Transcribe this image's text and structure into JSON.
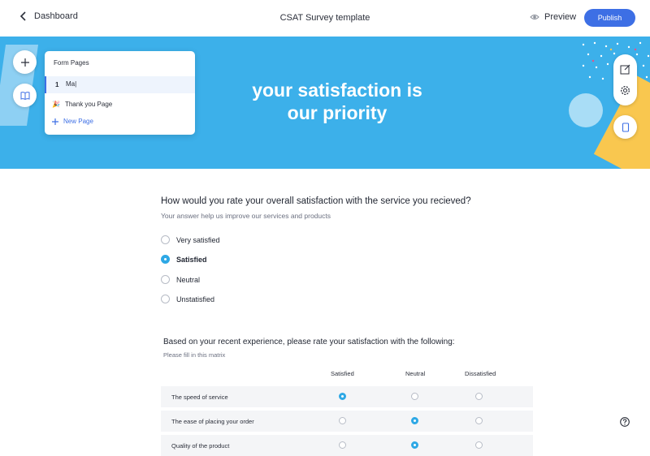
{
  "topbar": {
    "back_label": "Dashboard",
    "title": "CSAT Survey template",
    "preview_label": "Preview",
    "publish_label": "Publish"
  },
  "banner": {
    "headline_line1": "your satisfaction is",
    "headline_line2": "our priority"
  },
  "form_pages": {
    "title": "Form Pages",
    "active_page": {
      "number": "1",
      "value": "Ma"
    },
    "thank_you": {
      "icon": "party-popper-icon",
      "label": "Thank you Page"
    },
    "new_page": {
      "icon": "plus-icon",
      "label": "New Page"
    }
  },
  "question1": {
    "title": "How would you rate your overall satisfaction with the service you recieved?",
    "subtitle": "Your answer help us improve our services and products",
    "options": [
      {
        "label": "Very satisfied",
        "selected": false
      },
      {
        "label": "Satisfied",
        "selected": true
      },
      {
        "label": "Neutral",
        "selected": false
      },
      {
        "label": "Unstatisfied",
        "selected": false
      }
    ]
  },
  "question2": {
    "title": "Based on your recent experience, please rate your satisfaction with the following:",
    "subtitle": "Please fill in this matrix",
    "columns": [
      "Satisfied",
      "Neutral",
      "Dissatisfied"
    ],
    "rows": [
      {
        "label": "The speed of service",
        "selected": "Satisfied"
      },
      {
        "label": "The ease of placing your order",
        "selected": "Neutral"
      },
      {
        "label": "Quality of the product",
        "selected": "Neutral"
      }
    ]
  },
  "colors": {
    "accent": "#3d6fe5",
    "banner": "#3cb0ea",
    "radio_selected": "#2ea8e5",
    "banner_yellow": "#f9c74f"
  }
}
